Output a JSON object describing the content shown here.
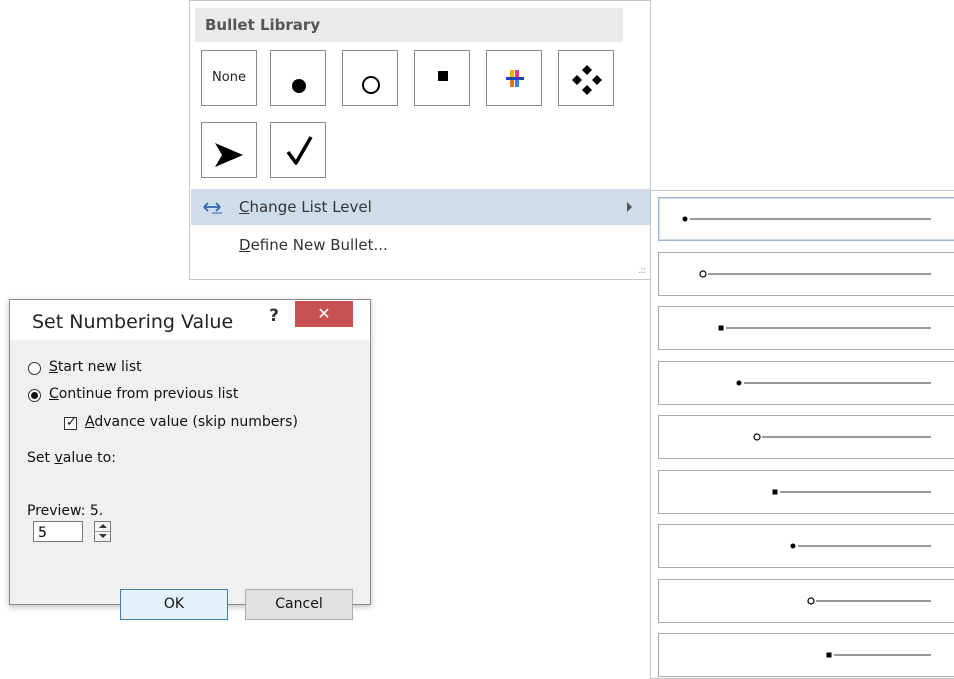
{
  "bullet_menu": {
    "title": "Bullet Library",
    "tiles": [
      {
        "label": "None",
        "icon": "none"
      },
      {
        "icon": "filled-circle-bullet"
      },
      {
        "icon": "hollow-circle-bullet"
      },
      {
        "icon": "filled-square-bullet"
      },
      {
        "icon": "multicolor-cross-bullet"
      },
      {
        "icon": "four-diamond-bullet"
      },
      {
        "icon": "arrowhead-bullet"
      },
      {
        "icon": "checkmark-bullet"
      }
    ],
    "change_level": {
      "prefix": "",
      "accel": "C",
      "rest": "hange List Level"
    },
    "define_bullet": {
      "accel": "D",
      "rest": "efine New Bullet..."
    }
  },
  "level_menu": {
    "levels": [
      {
        "bullet": "filled-circle"
      },
      {
        "bullet": "hollow-circle"
      },
      {
        "bullet": "filled-square"
      },
      {
        "bullet": "filled-circle"
      },
      {
        "bullet": "hollow-circle"
      },
      {
        "bullet": "filled-square"
      },
      {
        "bullet": "filled-circle"
      },
      {
        "bullet": "hollow-circle"
      },
      {
        "bullet": "filled-square"
      }
    ],
    "selected_index": 0
  },
  "dialog": {
    "title": "Set Numbering Value",
    "help": "?",
    "close": "✕",
    "start_new": {
      "accel": "S",
      "rest": "tart new list",
      "selected": false
    },
    "continue_prev": {
      "accel": "C",
      "rest": "ontinue from previous list",
      "selected": true
    },
    "advance": {
      "accel": "A",
      "rest": "dvance value (skip numbers)",
      "checked": true
    },
    "set_value_label_pre": "Set ",
    "set_value_label_accel": "v",
    "set_value_label_post": "alue to:",
    "value": "5",
    "preview": "Preview: 5.",
    "ok": "OK",
    "cancel": "Cancel"
  },
  "colors": {
    "highlight": "#cfdcea",
    "close_red": "#c75050",
    "dialog_bg": "#f0f0f0",
    "ok_border": "#3c7fb1"
  }
}
